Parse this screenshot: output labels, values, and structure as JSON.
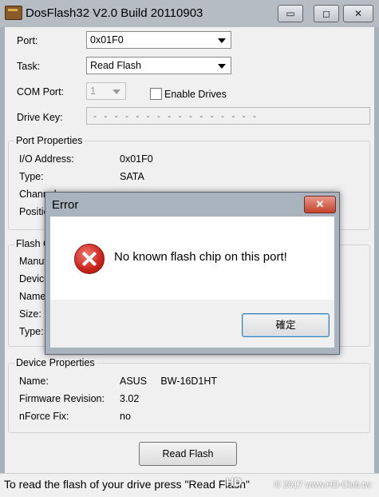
{
  "window": {
    "title": "DosFlash32 V2.0 Build 20110903",
    "controls": {
      "minimize": "▭",
      "maximize": "◻",
      "close": "✕"
    }
  },
  "form": {
    "port_label": "Port:",
    "port_value": "0x01F0",
    "task_label": "Task:",
    "task_value": "Read Flash",
    "com_port_label": "COM Port:",
    "com_port_value": "1",
    "enable_drives_label": "Enable Drives",
    "enable_drives_checked": false,
    "drive_key_label": "Drive Key:",
    "drive_key_value": "- - - - - - - - - - - - - - - -"
  },
  "port_properties": {
    "title": "Port Properties",
    "rows": [
      {
        "label": "I/O Address:",
        "value": "0x01F0"
      },
      {
        "label": "Type:",
        "value": "SATA"
      },
      {
        "label": "Channel",
        "value": ""
      },
      {
        "label": "Positio",
        "value": ""
      }
    ]
  },
  "flash_chip": {
    "title": "Flash C",
    "rows": [
      {
        "label": "Manuf"
      },
      {
        "label": "Device"
      },
      {
        "label": "Name"
      },
      {
        "label": "Size:"
      },
      {
        "label": "Type:"
      }
    ]
  },
  "device_properties": {
    "title": "Device Properties",
    "rows": [
      {
        "label": "Name:",
        "value": "ASUS     BW-16D1HT"
      },
      {
        "label": "Firmware Revision:",
        "value": "3.02"
      },
      {
        "label": "nForce Fix:",
        "value": "no"
      }
    ]
  },
  "action_button": "Read Flash",
  "status_bar": "To read the flash of your drive press \"Read Flash\"",
  "watermark": {
    "logo": "HD",
    "text": "© 2017 www.HD-Club.tw"
  },
  "dialog": {
    "title": "Error",
    "close": "✕",
    "message": "No known flash chip on this port!",
    "ok_button": "確定"
  }
}
